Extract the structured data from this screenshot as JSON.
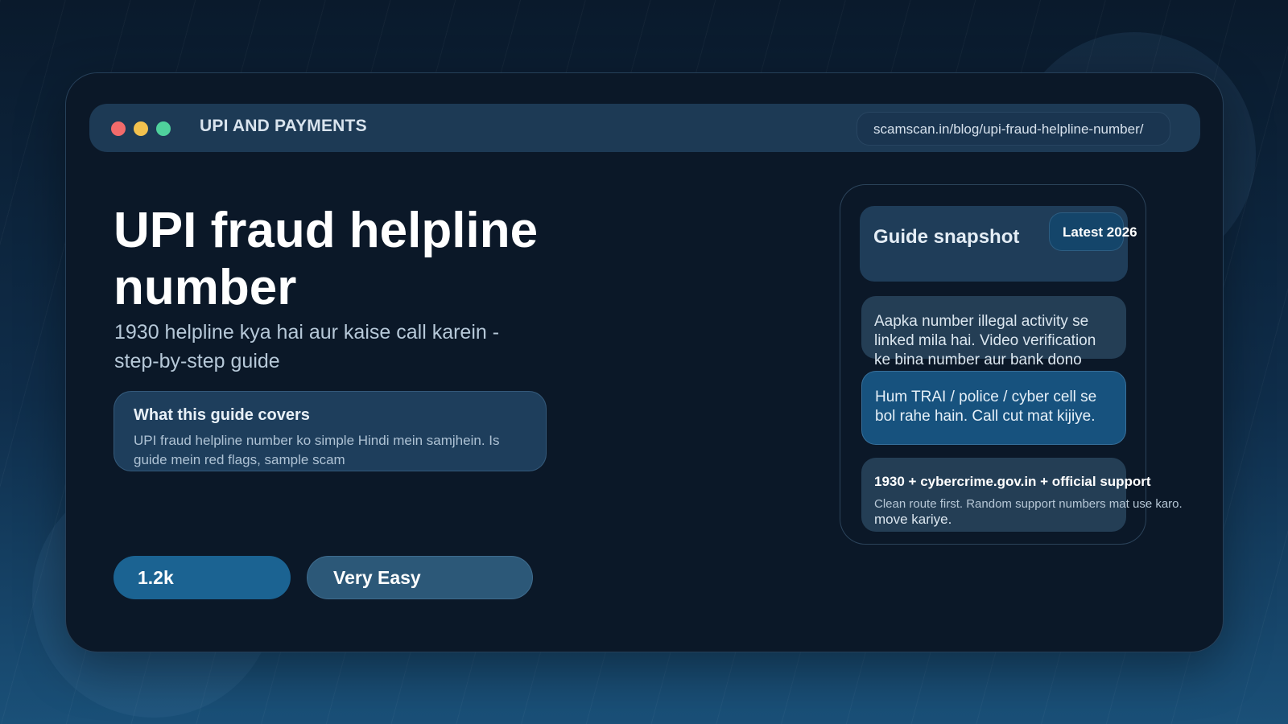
{
  "header": {
    "section_label": "UPI AND PAYMENTS",
    "url": "scamscan.in/blog/upi-fraud-helpline-number/"
  },
  "hero": {
    "title": "UPI fraud helpline number",
    "subtitle": "1930 helpline kya hai aur kaise call karein - step-by-step guide"
  },
  "covers": {
    "title": "What this guide covers",
    "text": "UPI fraud helpline number ko simple Hindi mein samjhein. Is guide mein red flags, sample scam"
  },
  "chips": {
    "stat": "1.2k",
    "level": "Very Easy"
  },
  "snapshot": {
    "title": "Guide snapshot",
    "badge": "Latest 2026",
    "messages": [
      "Aapka number illegal activity se linked mila hai. Video verification ke bina number aur bank dono",
      "Hum TRAI / police / cyber cell se bol rahe hain. Call cut mat kijiye."
    ],
    "route": {
      "title": "1930 + cybercrime.gov.in + official support",
      "subtitle": "Clean route first. Random support numbers mat use karo.",
      "tail": "move kariye."
    }
  },
  "colors": {
    "window_red": "#f26b6b",
    "window_yellow": "#f2c14e",
    "window_green": "#4fd19c",
    "accent_blue": "#1b6392",
    "card_bg": "#0b1828"
  }
}
